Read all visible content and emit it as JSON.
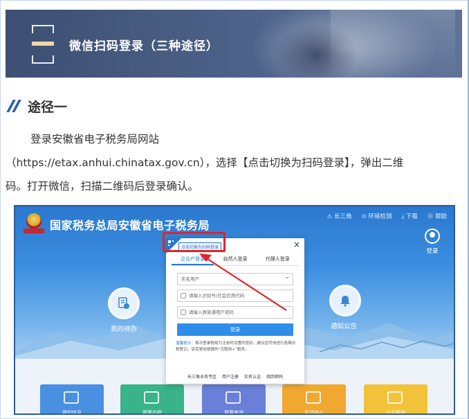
{
  "banner": {
    "title": "微信扫码登录（三种途径）"
  },
  "section": {
    "title": "途径一"
  },
  "paragraph": {
    "line1": "登录安徽省电子税务局网站",
    "line2": "（https://etax.anhui.chinatax.gov.cn），选择【点击切换为扫码登录】，弹出二维",
    "line3": "码。打开微信，扫描二维码后登录确认。"
  },
  "screenshot": {
    "site_title": "国家税务总局安徽省电子税务局",
    "top_links": [
      "⚠ 长三角",
      "⊙ 环境检测",
      "⤓ 下载",
      "⓪ 帮助"
    ],
    "login_label": "登录",
    "todo_label": "我的待办",
    "notice_label": "通知公告",
    "tiles": [
      {
        "label": "我的信息",
        "color": "#4a90e2"
      },
      {
        "label": "我要办税",
        "color": "#39b38a"
      },
      {
        "label": "我要查询",
        "color": "#6a7fd8"
      },
      {
        "label": "互动中心",
        "color": "#f0a830"
      },
      {
        "label": "公众服务",
        "color": "#f2c33a"
      }
    ],
    "dialog": {
      "qr_tip": "点击切换为扫码登录",
      "close": "×",
      "tabs": [
        "企业户登录",
        "自然人登录",
        "代理人登录"
      ],
      "select_value": "实名用户",
      "taxid_placeholder": "请输入识别号/社会信用代码",
      "password_placeholder": "请输入居家通用户密码",
      "login_button": "登录",
      "hint_label": "温馨提示：",
      "hint_text": "首次登录税局为注册时设置的密码，建议您尽快进行各案办税登记，享受更加便捷的“互联网+”服务。",
      "footer_links": [
        "长三角业务专区",
        "用户注册",
        "实名认证",
        "找回密码"
      ]
    }
  }
}
